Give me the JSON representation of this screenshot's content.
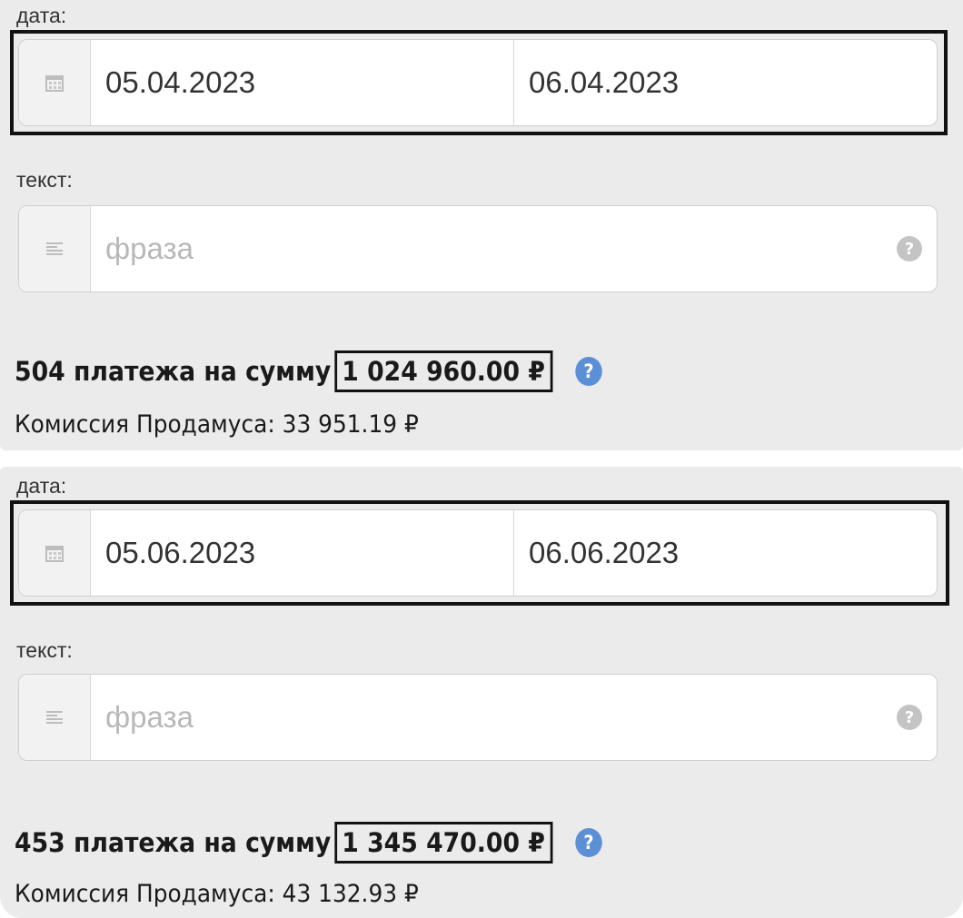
{
  "panels": [
    {
      "date_label": "дата:",
      "date_from": "05.04.2023",
      "date_to": "06.04.2023",
      "text_label": "текст:",
      "text_placeholder": "фраза",
      "summary_prefix": "504 платежа на сумму",
      "summary_total": "1 024 960.00 ₽",
      "commission": "Комиссия Продамуса: 33 951.19 ₽"
    },
    {
      "date_label": "дата:",
      "date_from": "05.06.2023",
      "date_to": "06.06.2023",
      "text_label": "текст:",
      "text_placeholder": "фраза",
      "summary_prefix": "453 платежа на сумму",
      "summary_total": "1 345 470.00 ₽",
      "commission": "Комиссия Продамуса: 43 132.93 ₽"
    }
  ],
  "icons": {
    "date_addon": "calendar-icon",
    "text_addon": "text-lines-icon",
    "field_help": "question-circle-icon",
    "summary_info": "info-question-icon"
  },
  "colors": {
    "panel_bg": "#ebebeb",
    "info_icon": "#5b8fd6",
    "help_icon": "#c4c4c4",
    "placeholder": "#b8b8b8"
  }
}
